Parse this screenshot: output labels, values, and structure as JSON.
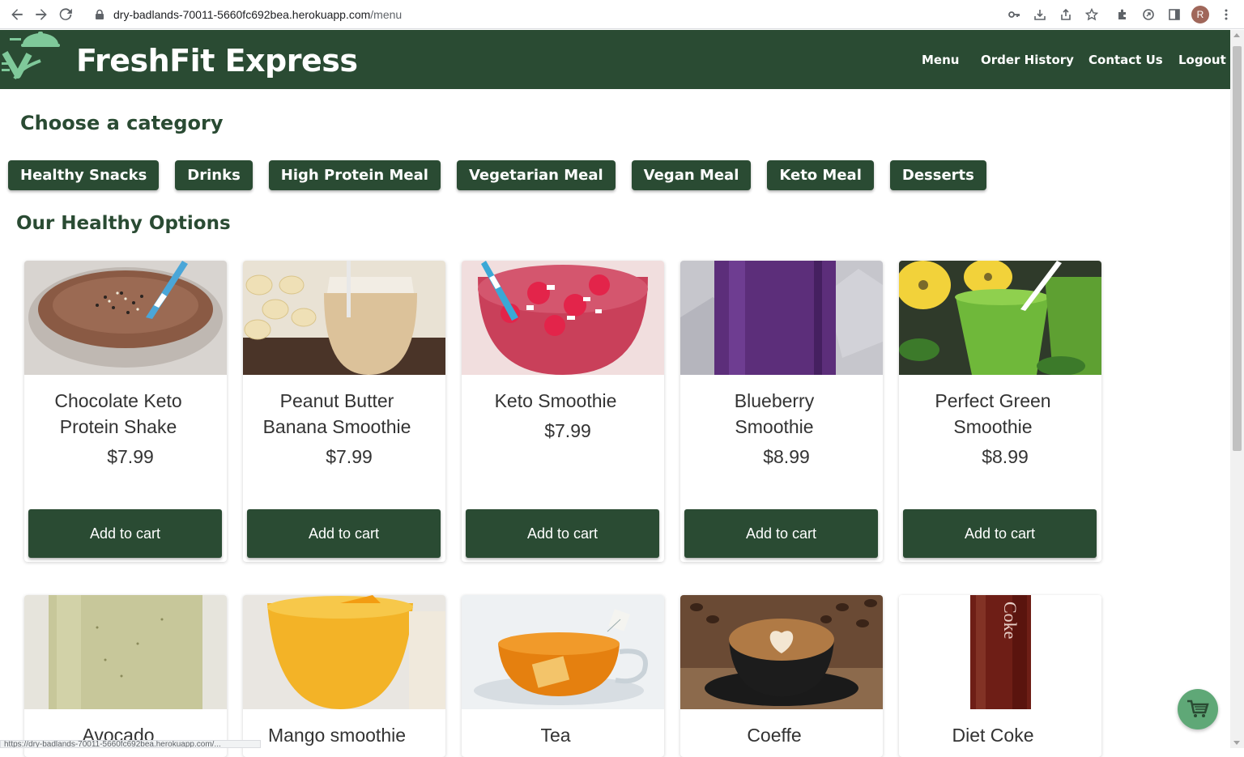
{
  "browser": {
    "url_host": "dry-badlands-70011-5660fc692bea.herokuapp.com",
    "url_path": "/menu",
    "profile_initial": "R",
    "status_url": "https://dry-badlands-70011-5660fc692bea.herokuapp.com/..."
  },
  "header": {
    "brand": "FreshFit Express",
    "nav": [
      "Menu",
      "Order History",
      "Contact Us",
      "Logout"
    ]
  },
  "categories": {
    "heading": "Choose a category",
    "items": [
      "Healthy Snacks",
      "Drinks",
      "High Protein Meal",
      "Vegetarian Meal",
      "Vegan Meal",
      "Keto Meal",
      "Desserts"
    ]
  },
  "options": {
    "heading": "Our Healthy Options",
    "add_label": "Add to cart",
    "products": [
      {
        "name": "Chocolate Keto Protein Shake",
        "price": "$7.99",
        "image": "chocolate-shake-image"
      },
      {
        "name": "Peanut Butter Banana Smoothie",
        "price": "$7.99",
        "image": "banana-smoothie-image"
      },
      {
        "name": "Keto Smoothie",
        "price": "$7.99",
        "image": "raspberry-smoothie-image"
      },
      {
        "name": "Blueberry Smoothie",
        "price": "$8.99",
        "image": "blueberry-smoothie-image"
      },
      {
        "name": "Perfect Green Smoothie",
        "price": "$8.99",
        "image": "green-smoothie-image"
      },
      {
        "name": "Avocado",
        "price": "",
        "image": "avocado-smoothie-image"
      },
      {
        "name": "Mango smoothie",
        "price": "",
        "image": "mango-smoothie-image"
      },
      {
        "name": "Tea",
        "price": "",
        "image": "tea-image"
      },
      {
        "name": "Coeffe",
        "price": "",
        "image": "coffee-image"
      },
      {
        "name": "Diet Coke",
        "price": "",
        "image": "diet-coke-image"
      }
    ]
  },
  "colors": {
    "brand_green": "#2a4b33",
    "cart_green": "#5fa877"
  },
  "icons": [
    "back-icon",
    "forward-icon",
    "reload-icon",
    "lock-icon",
    "key-icon",
    "install-icon",
    "share-icon",
    "star-icon",
    "extensions-icon",
    "sync-icon",
    "sidepanel-icon",
    "menu-dots-icon",
    "cart-icon"
  ]
}
